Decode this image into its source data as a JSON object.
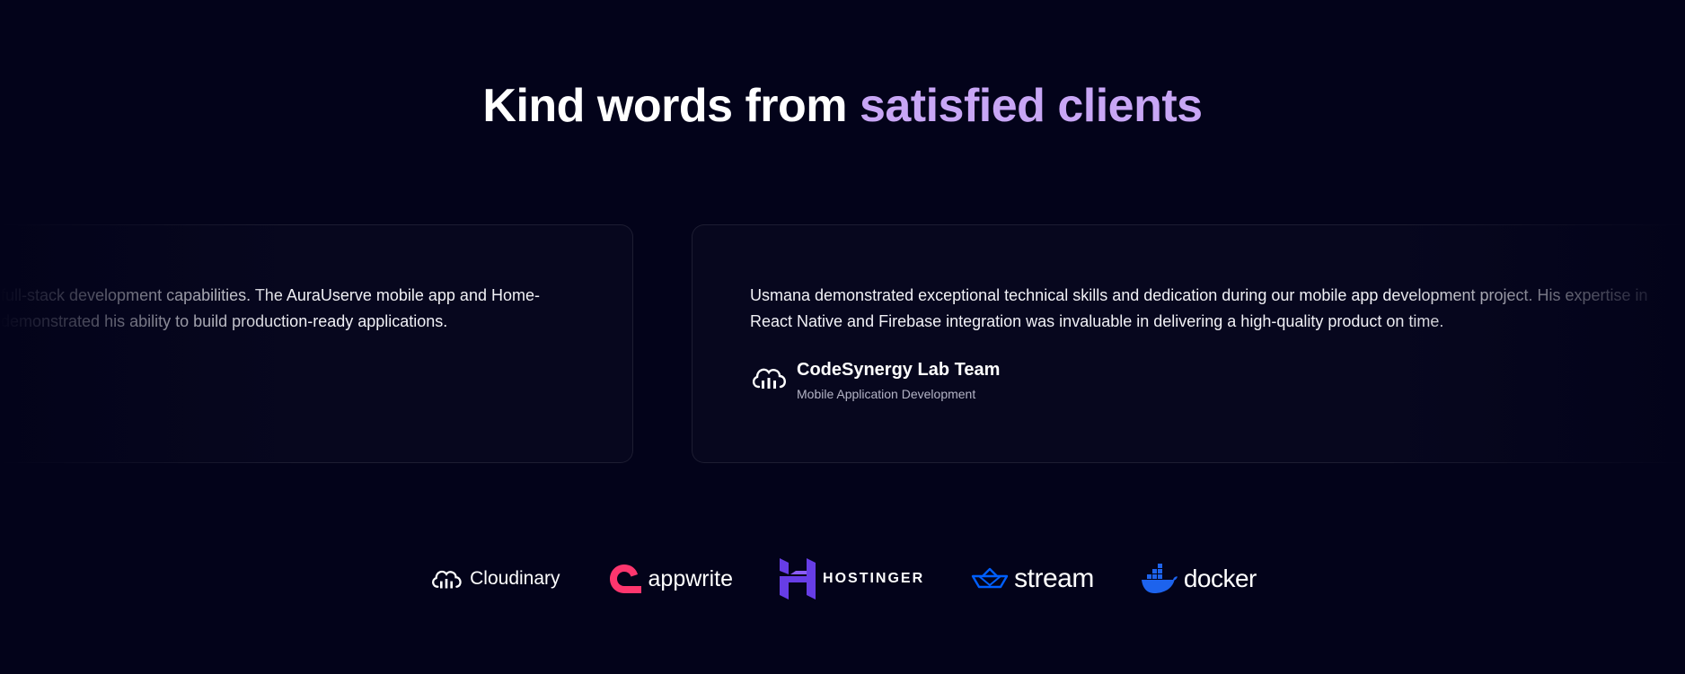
{
  "heading": {
    "part1": "Kind words from ",
    "accent": "satisfied clients",
    "accent_color": "#c8a6f5"
  },
  "testimonials": [
    {
      "quote": "full-stack development capabilities. The AuraUserve mobile app and Home- demonstrated his ability to build production-ready applications."
    },
    {
      "quote": "Usmana demonstrated exceptional technical skills and dedication during our mobile app development project. His expertise in React Native and Firebase integration was invaluable in delivering a high-quality product on time.",
      "author_icon": "cloud-upload-icon",
      "author_name": "CodeSynergy Lab Team",
      "author_role": "Mobile Application Development"
    }
  ],
  "logos": [
    {
      "name": "Cloudinary",
      "icon": "cloudinary-cloud-icon"
    },
    {
      "name": "appwrite",
      "icon": "appwrite-mark-icon",
      "color": "#fd366e"
    },
    {
      "name": "HOSTINGER",
      "icon": "hostinger-h-icon",
      "color": "#673de6"
    },
    {
      "name": "stream",
      "icon": "stream-boat-icon",
      "color": "#005fff"
    },
    {
      "name": "docker",
      "icon": "docker-whale-icon",
      "color": "#1d63ed"
    }
  ],
  "colors": {
    "background": "#03031a",
    "text": "#ffffff",
    "muted": "#b4b4c6"
  }
}
